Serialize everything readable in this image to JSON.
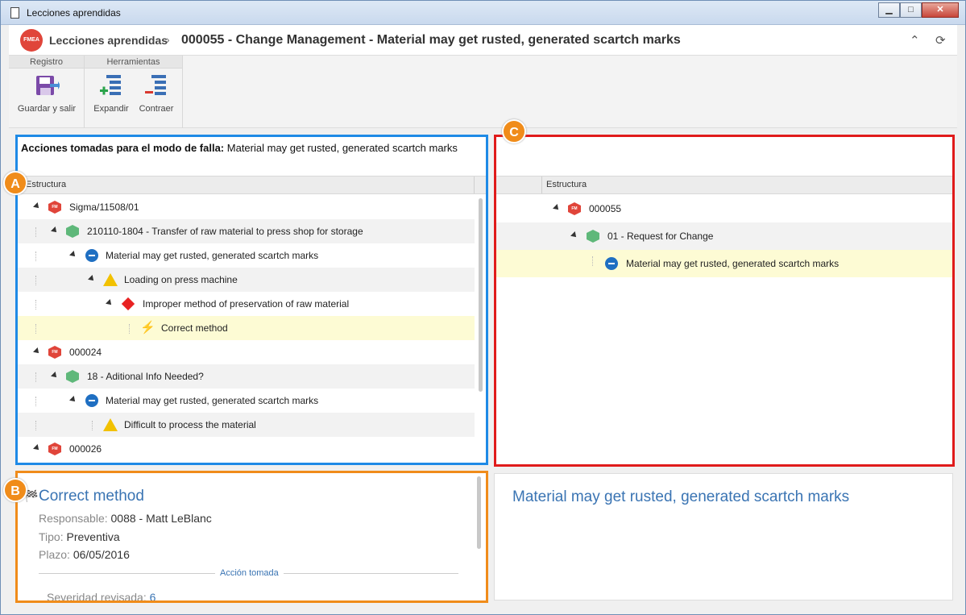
{
  "window": {
    "title": "Lecciones aprendidas",
    "buttons": [
      "minimize",
      "maximize",
      "close"
    ]
  },
  "header": {
    "logo_text": "FMEA",
    "breadcrumb": [
      "Lecciones aprendidas",
      "000055 - Change Management - Material may get rusted, generated scartch marks"
    ],
    "separator": "›"
  },
  "ribbon": {
    "groups": [
      {
        "title": "Registro",
        "buttons": [
          {
            "label": "Guardar y salir",
            "icon": "save-exit-icon"
          }
        ]
      },
      {
        "title": "Herramientas",
        "buttons": [
          {
            "label": "Expandir",
            "icon": "expand-tree-icon"
          },
          {
            "label": "Contraer",
            "icon": "collapse-tree-icon"
          }
        ]
      }
    ]
  },
  "panel_a": {
    "marker": "A",
    "title_label": "Acciones tomadas para el modo de falla:",
    "title_value": "Material may get rusted, generated scartch marks",
    "column": "Estructura",
    "rows": [
      {
        "label": "Sigma/11508/01",
        "icon": "fmea-hex-icon"
      },
      {
        "label": "210110-1804 - Transfer of raw material to press shop for storage",
        "icon": "process-hex-icon"
      },
      {
        "label": "Material may get rusted, generated scartch marks",
        "icon": "failure-mode-icon"
      },
      {
        "label": "Loading on press machine",
        "icon": "warning-triangle-icon"
      },
      {
        "label": "Improper method of preservation of raw material",
        "icon": "cause-diamond-icon"
      },
      {
        "label": "Correct method",
        "icon": "action-bolt-icon"
      },
      {
        "label": "000024",
        "icon": "fmea-hex-icon"
      },
      {
        "label": "18 - Aditional Info Needed?",
        "icon": "process-hex-icon"
      },
      {
        "label": "Material may get rusted, generated scartch marks",
        "icon": "failure-mode-icon"
      },
      {
        "label": "Difficult to process the material",
        "icon": "warning-triangle-icon"
      },
      {
        "label": "000026",
        "icon": "fmea-hex-icon"
      }
    ]
  },
  "panel_c": {
    "marker": "C",
    "column": "Estructura",
    "rows": [
      {
        "label": "000055",
        "icon": "fmea-hex-icon"
      },
      {
        "label": "01 - Request for Change",
        "icon": "process-hex-icon"
      },
      {
        "label": "Material may get rusted, generated scartch marks",
        "icon": "failure-mode-icon"
      }
    ]
  },
  "panel_b": {
    "marker": "B",
    "title": "Correct method",
    "responsable_label": "Responsable:",
    "responsable_value": "0088 - Matt LeBlanc",
    "tipo_label": "Tipo:",
    "tipo_value": "Preventiva",
    "plazo_label": "Plazo:",
    "plazo_value": "06/05/2016",
    "section_label": "Acción tomada",
    "severity_label": "Severidad revisada:",
    "severity_value": "6"
  },
  "panel_d": {
    "title": "Material may get rusted, generated scartch marks"
  },
  "colors": {
    "marker_orange": "#f08c1a",
    "panel_a_border": "#1e8ae6",
    "panel_b_border": "#f08c1a",
    "panel_c_border": "#e01b1b",
    "link_blue": "#3a74b3",
    "selected_row": "#fdfbd4"
  }
}
